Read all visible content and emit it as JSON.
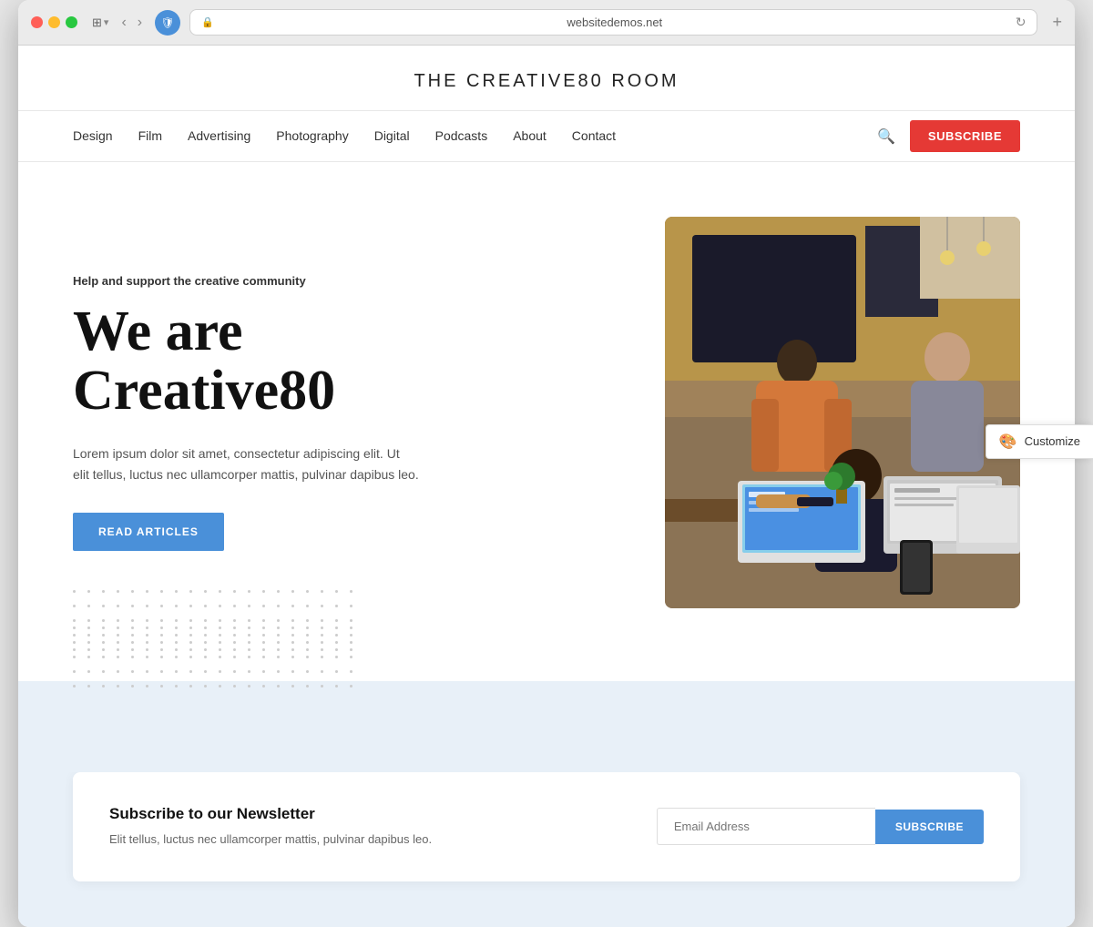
{
  "browser": {
    "url": "websitedemos.net",
    "new_tab_label": "+"
  },
  "site": {
    "title": "THE CREATIVE80 ROOM"
  },
  "nav": {
    "links": [
      {
        "label": "Design",
        "href": "#"
      },
      {
        "label": "Film",
        "href": "#"
      },
      {
        "label": "Advertising",
        "href": "#"
      },
      {
        "label": "Photography",
        "href": "#"
      },
      {
        "label": "Digital",
        "href": "#"
      },
      {
        "label": "Podcasts",
        "href": "#"
      },
      {
        "label": "About",
        "href": "#"
      },
      {
        "label": "Contact",
        "href": "#"
      }
    ],
    "subscribe_label": "SUBSCRIBE"
  },
  "hero": {
    "tagline": "Help and support the creative community",
    "title_line1": "We are",
    "title_line2": "Creative80",
    "description": "Lorem ipsum dolor sit amet, consectetur adipiscing elit. Ut elit tellus, luctus nec ullamcorper mattis, pulvinar dapibus leo.",
    "cta_label": "READ ARTICLES"
  },
  "newsletter": {
    "title": "Subscribe to our Newsletter",
    "description": "Elit tellus, luctus nec ullamcorper mattis, pulvinar dapibus leo.",
    "input_placeholder": "Email Address",
    "button_label": "SUBSCRIBE"
  },
  "customize": {
    "label": "Customize"
  }
}
